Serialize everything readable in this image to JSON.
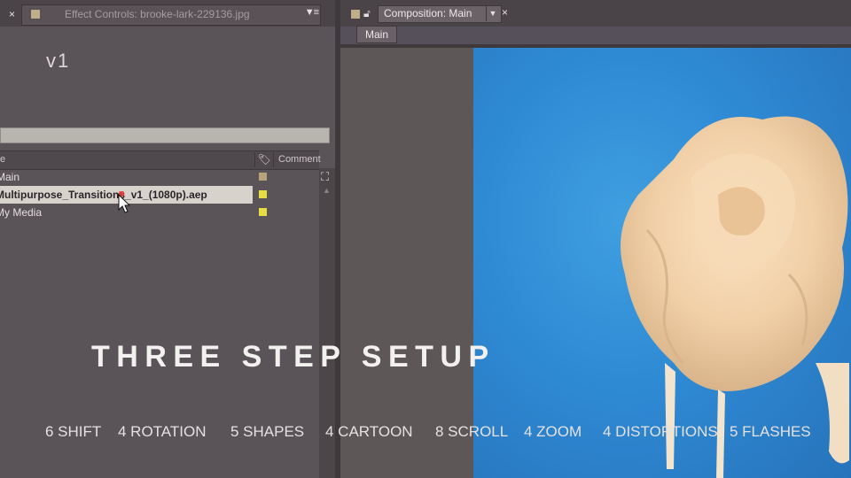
{
  "tabs": {
    "left_close": "×",
    "effect_controls": "Effect Controls: brooke-lark-229136.jpg",
    "panel_menu": "▼≡",
    "composition": "Composition: Main",
    "comp_close": "×"
  },
  "comp_subtab": "Main",
  "version_label": "v1",
  "project": {
    "header": {
      "name": "e",
      "comment": "Comment"
    },
    "items": [
      {
        "label": "Main",
        "color": "#b8a37c"
      },
      {
        "label": "Multipurpose_Transitions_v1_(1080p).aep",
        "color": "#e6dc44",
        "selected": true
      },
      {
        "label": "My Media",
        "color": "#e6dc44"
      }
    ]
  },
  "overlay": {
    "headline": "THREE STEP SETUP",
    "features": [
      "6 SHIFT",
      "4 ROTATION",
      "5 SHAPES",
      "4 CARTOON",
      "8 SCROLL",
      "4 ZOOM",
      "4 DISTORTIONS",
      "5 FLASHES"
    ]
  },
  "colors": {
    "viewer_blue": "#2f8ad4",
    "panel_bg": "#5a5357"
  }
}
